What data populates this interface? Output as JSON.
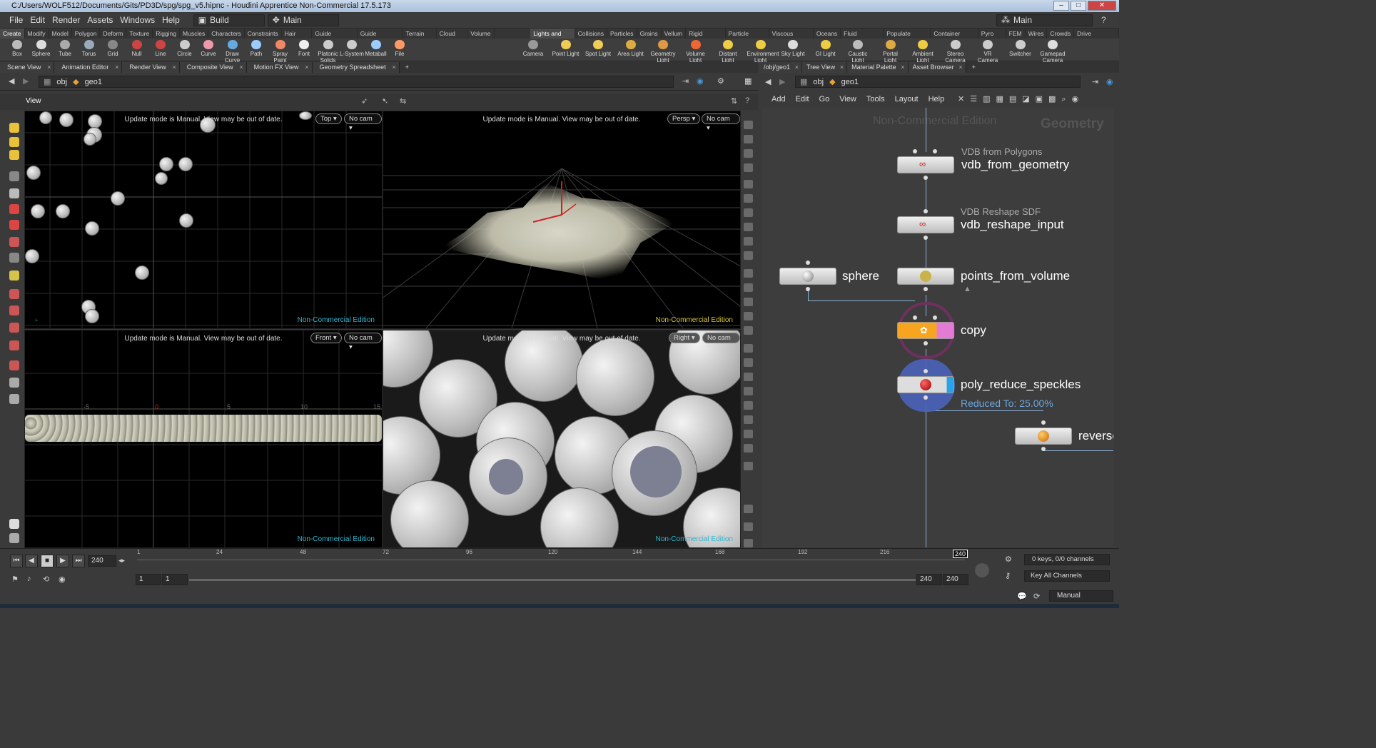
{
  "window": {
    "title": "C:/Users/WOLF512/Documents/Gits/PD3D/spg/spg_v5.hipnc - Houdini Apprentice Non-Commercial 17.5.173"
  },
  "menu": {
    "items": [
      "File",
      "Edit",
      "Render",
      "Assets",
      "Windows",
      "Help"
    ],
    "desktop": "Build",
    "desktop_right": "Main",
    "desktop_left_main": "Main"
  },
  "shelf_tabs_left": [
    "Create",
    "Modify",
    "Model",
    "Polygon",
    "Deform",
    "Texture",
    "Rigging",
    "Muscles",
    "Characters",
    "Constraints",
    "Hair Utils",
    "Guide Process",
    "Guide Brushes",
    "Terrain FX",
    "Cloud FX",
    "Volume"
  ],
  "shelf_tabs_right": [
    "Lights and C...",
    "Collisions",
    "Particles",
    "Grains",
    "Vellum",
    "Rigid Bodies",
    "Particle Fluids",
    "Viscous Fluids",
    "Oceans",
    "Fluid Contai...",
    "Populate Con...",
    "Container Tools",
    "Pyro FX",
    "FEM",
    "Wires",
    "Crowds",
    "Drive Simula..."
  ],
  "tools_left": [
    {
      "label": "Box",
      "icon": "box-icon"
    },
    {
      "label": "Sphere",
      "icon": "sphere-icon"
    },
    {
      "label": "Tube",
      "icon": "tube-icon"
    },
    {
      "label": "Torus",
      "icon": "torus-icon"
    },
    {
      "label": "Grid",
      "icon": "grid-icon"
    },
    {
      "label": "Null",
      "icon": "null-icon"
    },
    {
      "label": "Line",
      "icon": "line-icon"
    },
    {
      "label": "Circle",
      "icon": "circle-icon"
    },
    {
      "label": "Curve",
      "icon": "curve-icon"
    },
    {
      "label": "Draw Curve",
      "icon": "draw-curve-icon"
    },
    {
      "label": "Path",
      "icon": "path-icon"
    },
    {
      "label": "Spray Paint",
      "icon": "spray-paint-icon"
    },
    {
      "label": "Font",
      "icon": "font-icon"
    },
    {
      "label": "Platonic Solids",
      "icon": "platonic-icon"
    },
    {
      "label": "L-System",
      "icon": "lsystem-icon"
    },
    {
      "label": "Metaball",
      "icon": "metaball-icon"
    },
    {
      "label": "File",
      "icon": "file-icon"
    }
  ],
  "tools_right": [
    {
      "label": "Camera"
    },
    {
      "label": "Point Light"
    },
    {
      "label": "Spot Light"
    },
    {
      "label": "Area Light"
    },
    {
      "label": "Geometry Light"
    },
    {
      "label": "Volume Light"
    },
    {
      "label": "Distant Light"
    },
    {
      "label": "Environment Light"
    },
    {
      "label": "Sky Light"
    },
    {
      "label": "GI Light"
    },
    {
      "label": "Caustic Light"
    },
    {
      "label": "Portal Light"
    },
    {
      "label": "Ambient Light"
    },
    {
      "label": "Stereo Camera"
    },
    {
      "label": "VR Camera"
    },
    {
      "label": "Switcher"
    },
    {
      "label": "Gamepad Camera"
    }
  ],
  "pane_tabs": [
    "Scene View",
    "Animation Editor",
    "Render View",
    "Composite View",
    "Motion FX View",
    "Geometry Spreadsheet"
  ],
  "path": {
    "obj": "obj",
    "geo": "geo1"
  },
  "view_label": "View",
  "viewports": {
    "msg": "Update mode is Manual. View may be out of date.",
    "nce": "Non-Commercial Edition",
    "top": {
      "view": "Top",
      "cam": "No cam"
    },
    "persp": {
      "view": "Persp",
      "cam": "No cam"
    },
    "front": {
      "view": "Front",
      "cam": "No cam"
    },
    "right": {
      "view": "Right",
      "cam": "No cam"
    },
    "front_ticks": [
      "-5",
      "0",
      "5",
      "10",
      "15"
    ]
  },
  "net": {
    "tabs": [
      "/obj/geo1",
      "Tree View",
      "Material Palette",
      "Asset Browser"
    ],
    "path_obj": "obj",
    "path_geo": "geo1",
    "menu": [
      "Add",
      "Edit",
      "Go",
      "View",
      "Tools",
      "Layout",
      "Help"
    ],
    "watermark": "Non-Commercial Edition",
    "context": "Geometry",
    "nodes": [
      {
        "type": "VDB from Polygons",
        "name": "vdb_from_geometry"
      },
      {
        "type": "VDB Reshape SDF",
        "name": "vdb_reshape_input"
      },
      {
        "type": "",
        "name": "sphere"
      },
      {
        "type": "",
        "name": "points_from_volume"
      },
      {
        "type": "",
        "name": "copy"
      },
      {
        "type": "",
        "name": "poly_reduce_speckles",
        "note": "Reduced To: 25.00%"
      },
      {
        "type": "",
        "name": "reverse"
      }
    ]
  },
  "timeline": {
    "frame": "240",
    "start": "1",
    "start2": "1",
    "end": "240",
    "end2": "240",
    "marker": "240",
    "ticks": [
      "1",
      "24",
      "48",
      "72",
      "96",
      "120",
      "144",
      "168",
      "192",
      "216"
    ],
    "keys": "0 keys, 0/0 channels",
    "key_all": "Key All Channels",
    "update": "Manual"
  }
}
